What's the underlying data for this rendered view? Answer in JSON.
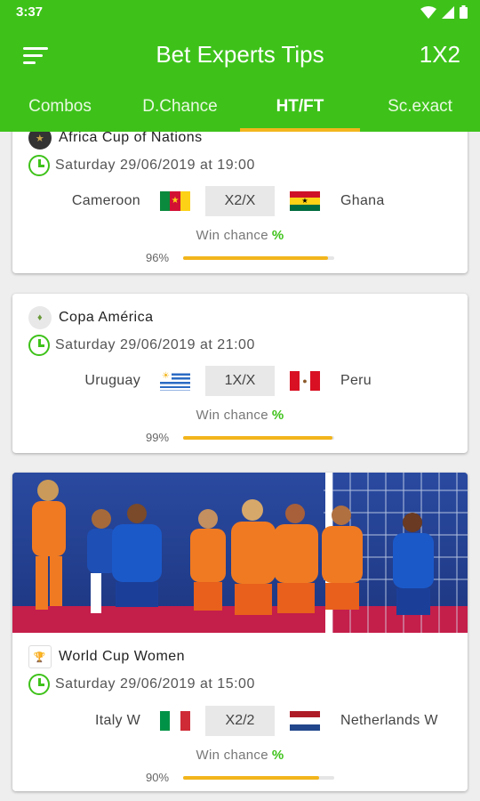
{
  "status": {
    "time": "3:37"
  },
  "appbar": {
    "title": "Bet Experts Tips",
    "action": "1X2"
  },
  "tabs": [
    {
      "label": "Combos"
    },
    {
      "label": "D.Chance"
    },
    {
      "label": "HT/FT",
      "active": true
    },
    {
      "label": "Sc.exact"
    }
  ],
  "matches": [
    {
      "league": "Africa Cup of Nations",
      "datetime": "Saturday 29/06/2019 at 19:00",
      "home": "Cameroon",
      "away": "Ghana",
      "tip": "X2/X",
      "win_label": "Win chance",
      "win_symbol": "%",
      "percent_text": "96%",
      "percent": 96
    },
    {
      "league": "Copa América",
      "datetime": "Saturday 29/06/2019  at 21:00",
      "home": "Uruguay",
      "away": "Peru",
      "tip": "1X/X",
      "win_label": "Win chance",
      "win_symbol": "%",
      "percent_text": "99%",
      "percent": 99
    },
    {
      "league": "World Cup Women",
      "datetime": "Saturday 29/06/2019 at  15:00",
      "home": "Italy W",
      "away": "Netherlands W",
      "tip": "X2/2",
      "win_label": "Win chance",
      "win_symbol": "%",
      "percent_text": "90%",
      "percent": 90
    }
  ],
  "colors": {
    "primary": "#3ec21a",
    "accent": "#f2b51c"
  }
}
